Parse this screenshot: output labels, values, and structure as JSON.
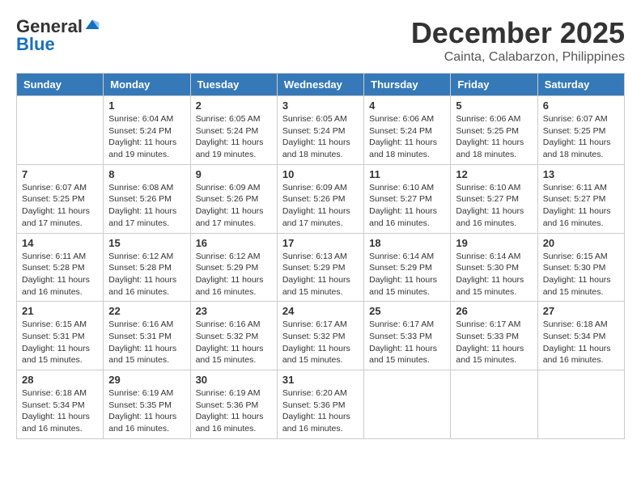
{
  "header": {
    "logo_general": "General",
    "logo_blue": "Blue",
    "month_title": "December 2025",
    "location": "Cainta, Calabarzon, Philippines"
  },
  "days_of_week": [
    "Sunday",
    "Monday",
    "Tuesday",
    "Wednesday",
    "Thursday",
    "Friday",
    "Saturday"
  ],
  "weeks": [
    [
      {
        "day": "",
        "info": ""
      },
      {
        "day": "1",
        "info": "Sunrise: 6:04 AM\nSunset: 5:24 PM\nDaylight: 11 hours\nand 19 minutes."
      },
      {
        "day": "2",
        "info": "Sunrise: 6:05 AM\nSunset: 5:24 PM\nDaylight: 11 hours\nand 19 minutes."
      },
      {
        "day": "3",
        "info": "Sunrise: 6:05 AM\nSunset: 5:24 PM\nDaylight: 11 hours\nand 18 minutes."
      },
      {
        "day": "4",
        "info": "Sunrise: 6:06 AM\nSunset: 5:24 PM\nDaylight: 11 hours\nand 18 minutes."
      },
      {
        "day": "5",
        "info": "Sunrise: 6:06 AM\nSunset: 5:25 PM\nDaylight: 11 hours\nand 18 minutes."
      },
      {
        "day": "6",
        "info": "Sunrise: 6:07 AM\nSunset: 5:25 PM\nDaylight: 11 hours\nand 18 minutes."
      }
    ],
    [
      {
        "day": "7",
        "info": "Sunrise: 6:07 AM\nSunset: 5:25 PM\nDaylight: 11 hours\nand 17 minutes."
      },
      {
        "day": "8",
        "info": "Sunrise: 6:08 AM\nSunset: 5:26 PM\nDaylight: 11 hours\nand 17 minutes."
      },
      {
        "day": "9",
        "info": "Sunrise: 6:09 AM\nSunset: 5:26 PM\nDaylight: 11 hours\nand 17 minutes."
      },
      {
        "day": "10",
        "info": "Sunrise: 6:09 AM\nSunset: 5:26 PM\nDaylight: 11 hours\nand 17 minutes."
      },
      {
        "day": "11",
        "info": "Sunrise: 6:10 AM\nSunset: 5:27 PM\nDaylight: 11 hours\nand 16 minutes."
      },
      {
        "day": "12",
        "info": "Sunrise: 6:10 AM\nSunset: 5:27 PM\nDaylight: 11 hours\nand 16 minutes."
      },
      {
        "day": "13",
        "info": "Sunrise: 6:11 AM\nSunset: 5:27 PM\nDaylight: 11 hours\nand 16 minutes."
      }
    ],
    [
      {
        "day": "14",
        "info": "Sunrise: 6:11 AM\nSunset: 5:28 PM\nDaylight: 11 hours\nand 16 minutes."
      },
      {
        "day": "15",
        "info": "Sunrise: 6:12 AM\nSunset: 5:28 PM\nDaylight: 11 hours\nand 16 minutes."
      },
      {
        "day": "16",
        "info": "Sunrise: 6:12 AM\nSunset: 5:29 PM\nDaylight: 11 hours\nand 16 minutes."
      },
      {
        "day": "17",
        "info": "Sunrise: 6:13 AM\nSunset: 5:29 PM\nDaylight: 11 hours\nand 15 minutes."
      },
      {
        "day": "18",
        "info": "Sunrise: 6:14 AM\nSunset: 5:29 PM\nDaylight: 11 hours\nand 15 minutes."
      },
      {
        "day": "19",
        "info": "Sunrise: 6:14 AM\nSunset: 5:30 PM\nDaylight: 11 hours\nand 15 minutes."
      },
      {
        "day": "20",
        "info": "Sunrise: 6:15 AM\nSunset: 5:30 PM\nDaylight: 11 hours\nand 15 minutes."
      }
    ],
    [
      {
        "day": "21",
        "info": "Sunrise: 6:15 AM\nSunset: 5:31 PM\nDaylight: 11 hours\nand 15 minutes."
      },
      {
        "day": "22",
        "info": "Sunrise: 6:16 AM\nSunset: 5:31 PM\nDaylight: 11 hours\nand 15 minutes."
      },
      {
        "day": "23",
        "info": "Sunrise: 6:16 AM\nSunset: 5:32 PM\nDaylight: 11 hours\nand 15 minutes."
      },
      {
        "day": "24",
        "info": "Sunrise: 6:17 AM\nSunset: 5:32 PM\nDaylight: 11 hours\nand 15 minutes."
      },
      {
        "day": "25",
        "info": "Sunrise: 6:17 AM\nSunset: 5:33 PM\nDaylight: 11 hours\nand 15 minutes."
      },
      {
        "day": "26",
        "info": "Sunrise: 6:17 AM\nSunset: 5:33 PM\nDaylight: 11 hours\nand 15 minutes."
      },
      {
        "day": "27",
        "info": "Sunrise: 6:18 AM\nSunset: 5:34 PM\nDaylight: 11 hours\nand 16 minutes."
      }
    ],
    [
      {
        "day": "28",
        "info": "Sunrise: 6:18 AM\nSunset: 5:34 PM\nDaylight: 11 hours\nand 16 minutes."
      },
      {
        "day": "29",
        "info": "Sunrise: 6:19 AM\nSunset: 5:35 PM\nDaylight: 11 hours\nand 16 minutes."
      },
      {
        "day": "30",
        "info": "Sunrise: 6:19 AM\nSunset: 5:36 PM\nDaylight: 11 hours\nand 16 minutes."
      },
      {
        "day": "31",
        "info": "Sunrise: 6:20 AM\nSunset: 5:36 PM\nDaylight: 11 hours\nand 16 minutes."
      },
      {
        "day": "",
        "info": ""
      },
      {
        "day": "",
        "info": ""
      },
      {
        "day": "",
        "info": ""
      }
    ]
  ]
}
